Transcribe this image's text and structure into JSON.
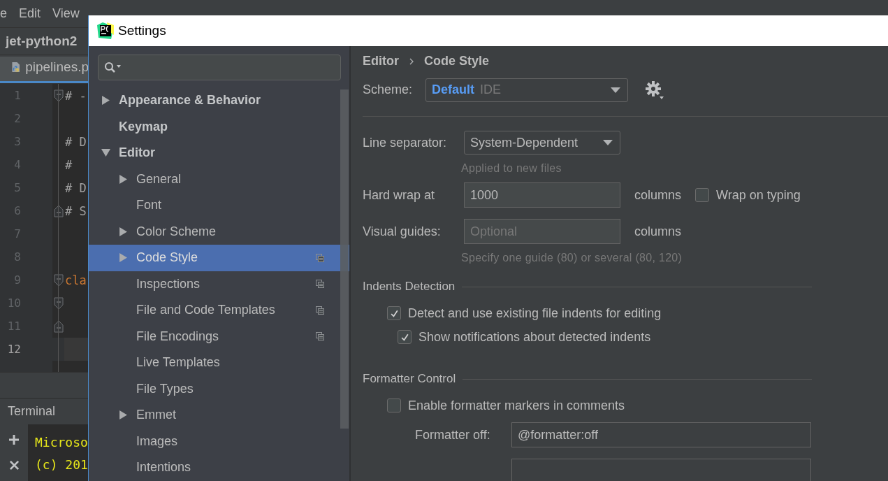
{
  "ide": {
    "menu": [
      "e",
      "Edit",
      "View"
    ],
    "project": "jet-python2",
    "file_tab": "pipelines.p",
    "code_lines": [
      {
        "number": "1",
        "text": "# -",
        "kind": "comment",
        "fold_start": true,
        "fold_end": false,
        "current": false
      },
      {
        "number": "2",
        "fold_start": false,
        "fold_end": false,
        "current": false
      },
      {
        "number": "3",
        "text": "# D",
        "kind": "comment",
        "fold_start": false,
        "fold_end": false,
        "current": false
      },
      {
        "number": "4",
        "text": "#",
        "kind": "comment",
        "fold_start": false,
        "fold_end": false,
        "current": false
      },
      {
        "number": "5",
        "text": "# D",
        "kind": "comment",
        "fold_start": false,
        "fold_end": false,
        "current": false
      },
      {
        "number": "6",
        "text": "# S",
        "kind": "comment",
        "fold_start": false,
        "fold_end": true,
        "current": false
      },
      {
        "number": "7",
        "fold_start": false,
        "fold_end": false,
        "current": false
      },
      {
        "number": "8",
        "fold_start": false,
        "fold_end": false,
        "current": false
      },
      {
        "number": "9",
        "text": "cla",
        "kind": "keyword",
        "fold_start": true,
        "fold_end": false,
        "current": false
      },
      {
        "number": "10",
        "fold_start": true,
        "fold_end": false,
        "current": false
      },
      {
        "number": "11",
        "fold_start": false,
        "fold_end": true,
        "current": false
      },
      {
        "number": "12",
        "fold_start": false,
        "fold_end": false,
        "current": true
      }
    ],
    "terminal": {
      "title": "Terminal",
      "lines": [
        "Microso",
        "(c) 201"
      ]
    }
  },
  "settings": {
    "title": "Settings",
    "tree": [
      {
        "label": "Appearance & Behavior",
        "expandable": true,
        "expanded": false,
        "selected": false
      },
      {
        "label": "Keymap",
        "expandable": false,
        "selected": false
      },
      {
        "label": "Editor",
        "expandable": true,
        "expanded": true,
        "selected": false,
        "children": [
          {
            "label": "General",
            "expandable": true,
            "expanded": false,
            "selected": false,
            "project_level": false
          },
          {
            "label": "Font",
            "expandable": false,
            "selected": false,
            "project_level": false
          },
          {
            "label": "Color Scheme",
            "expandable": true,
            "expanded": false,
            "selected": false,
            "project_level": false
          },
          {
            "label": "Code Style",
            "expandable": true,
            "expanded": false,
            "selected": true,
            "project_level": true
          },
          {
            "label": "Inspections",
            "expandable": false,
            "selected": false,
            "project_level": true
          },
          {
            "label": "File and Code Templates",
            "expandable": false,
            "selected": false,
            "project_level": true
          },
          {
            "label": "File Encodings",
            "expandable": false,
            "selected": false,
            "project_level": true
          },
          {
            "label": "Live Templates",
            "expandable": false,
            "selected": false,
            "project_level": false
          },
          {
            "label": "File Types",
            "expandable": false,
            "selected": false,
            "project_level": false
          },
          {
            "label": "Emmet",
            "expandable": true,
            "expanded": false,
            "selected": false,
            "project_level": false
          },
          {
            "label": "Images",
            "expandable": false,
            "selected": false,
            "project_level": false
          },
          {
            "label": "Intentions",
            "expandable": false,
            "selected": false,
            "project_level": false
          }
        ]
      }
    ],
    "breadcrumb": [
      "Editor",
      "Code Style"
    ],
    "scheme": {
      "label": "Scheme:",
      "name": "Default",
      "suffix": "IDE"
    },
    "line_separator": {
      "label": "Line separator:",
      "value": "System-Dependent",
      "hint": "Applied to new files"
    },
    "hard_wrap": {
      "label": "Hard wrap at",
      "value": "1000",
      "unit": "columns"
    },
    "wrap_on_typing": {
      "label": "Wrap on typing",
      "checked": false
    },
    "visual_guides": {
      "label": "Visual guides:",
      "placeholder": "Optional",
      "unit": "columns",
      "hint": "Specify one guide (80) or several (80, 120)"
    },
    "indents_detection": {
      "title": "Indents Detection",
      "options": [
        {
          "label": "Detect and use existing file indents for editing",
          "checked": true,
          "children": [
            {
              "label": "Show notifications about detected indents",
              "checked": true
            }
          ]
        }
      ]
    },
    "formatter_control": {
      "title": "Formatter Control",
      "enable": {
        "label": "Enable formatter markers in comments",
        "checked": false
      },
      "off": {
        "label": "Formatter off:",
        "value": "@formatter:off"
      }
    }
  }
}
